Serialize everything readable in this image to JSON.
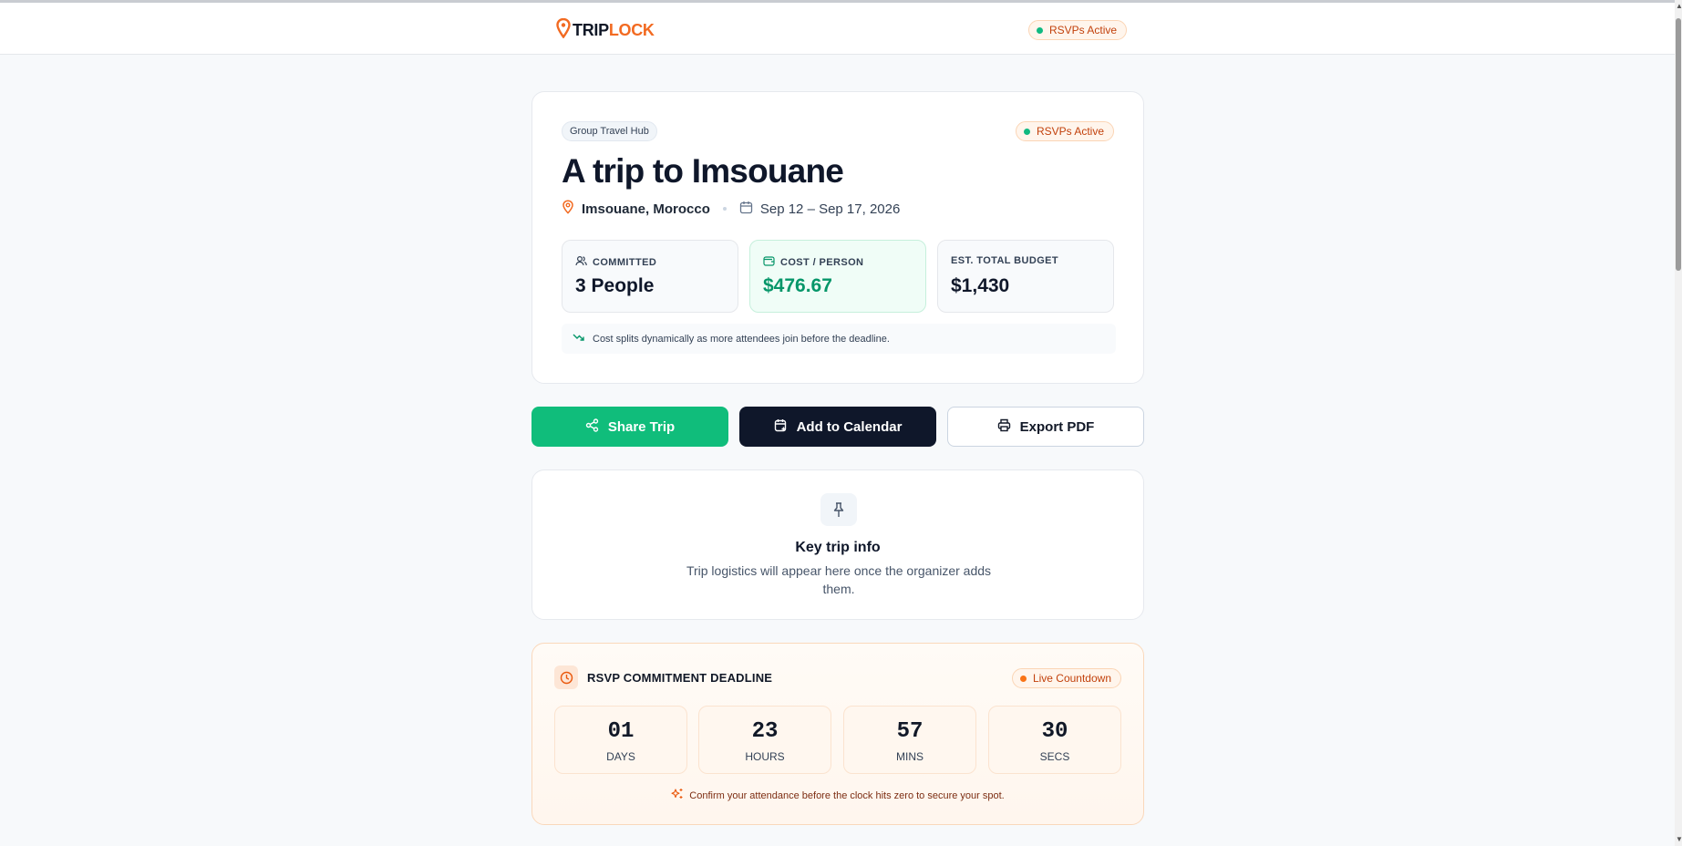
{
  "header": {
    "logo_part1": "TRIP",
    "logo_part2": "LOCK",
    "status_pill": "RSVPs Active"
  },
  "hero": {
    "chip": "Group Travel Hub",
    "status_pill": "RSVPs Active",
    "title": "A trip to Imsouane",
    "location": "Imsouane, Morocco",
    "dates": "Sep 12 – Sep 17, 2026",
    "stats": [
      {
        "label": "COMMITTED",
        "value": "3 People"
      },
      {
        "label": "COST / PERSON",
        "value": "$476.67"
      },
      {
        "label": "EST. TOTAL BUDGET",
        "value": "$1,430"
      }
    ],
    "note": "Cost splits dynamically as more attendees join before the deadline."
  },
  "actions": {
    "share": "Share Trip",
    "calendar": "Add to Calendar",
    "export": "Export PDF"
  },
  "info": {
    "title": "Key trip info",
    "body": "Trip logistics will appear here once the organizer adds them."
  },
  "deadline": {
    "title": "RSVP COMMITMENT DEADLINE",
    "pill": "Live Countdown",
    "countdown": [
      {
        "value": "01",
        "unit": "DAYS"
      },
      {
        "value": "23",
        "unit": "HOURS"
      },
      {
        "value": "57",
        "unit": "MINS"
      },
      {
        "value": "30",
        "unit": "SECS"
      }
    ],
    "footer": "Confirm your attendance before the clock hits zero to secure your spot."
  },
  "colors": {
    "brand": "#f26a21",
    "green": "#10bd7b",
    "dark": "#0f172a"
  }
}
